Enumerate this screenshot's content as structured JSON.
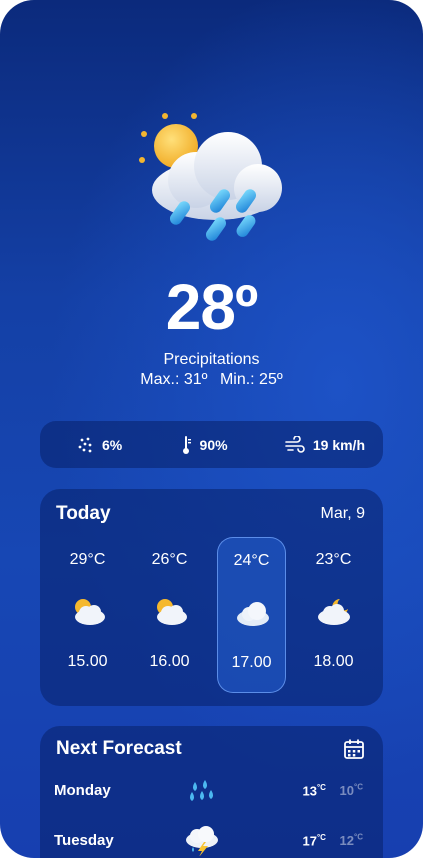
{
  "current": {
    "temperature": "28º",
    "condition": "Precipitations",
    "max": "Max.: 31º",
    "min": "Min.: 25º",
    "icon": "sun-cloud-rain-icon"
  },
  "stats": {
    "rain": "6%",
    "humidity": "90%",
    "wind": "19 km/h"
  },
  "today": {
    "title": "Today",
    "date": "Mar, 9",
    "hours": [
      {
        "temp": "29°C",
        "time": "15.00",
        "icon": "partly-cloudy-icon"
      },
      {
        "temp": "26°C",
        "time": "16.00",
        "icon": "partly-cloudy-icon"
      },
      {
        "temp": "24°C",
        "time": "17.00",
        "icon": "cloud-icon"
      },
      {
        "temp": "23°C",
        "time": "18.00",
        "icon": "cloud-moon-icon"
      }
    ]
  },
  "forecast": {
    "title": "Next Forecast",
    "days": [
      {
        "day": "Monday",
        "high": "13",
        "low": "10",
        "unit": "°C",
        "icon": "rain-drops-icon"
      },
      {
        "day": "Tuesday",
        "high": "17",
        "low": "12",
        "unit": "°C",
        "icon": "thunderstorm-icon"
      }
    ]
  }
}
